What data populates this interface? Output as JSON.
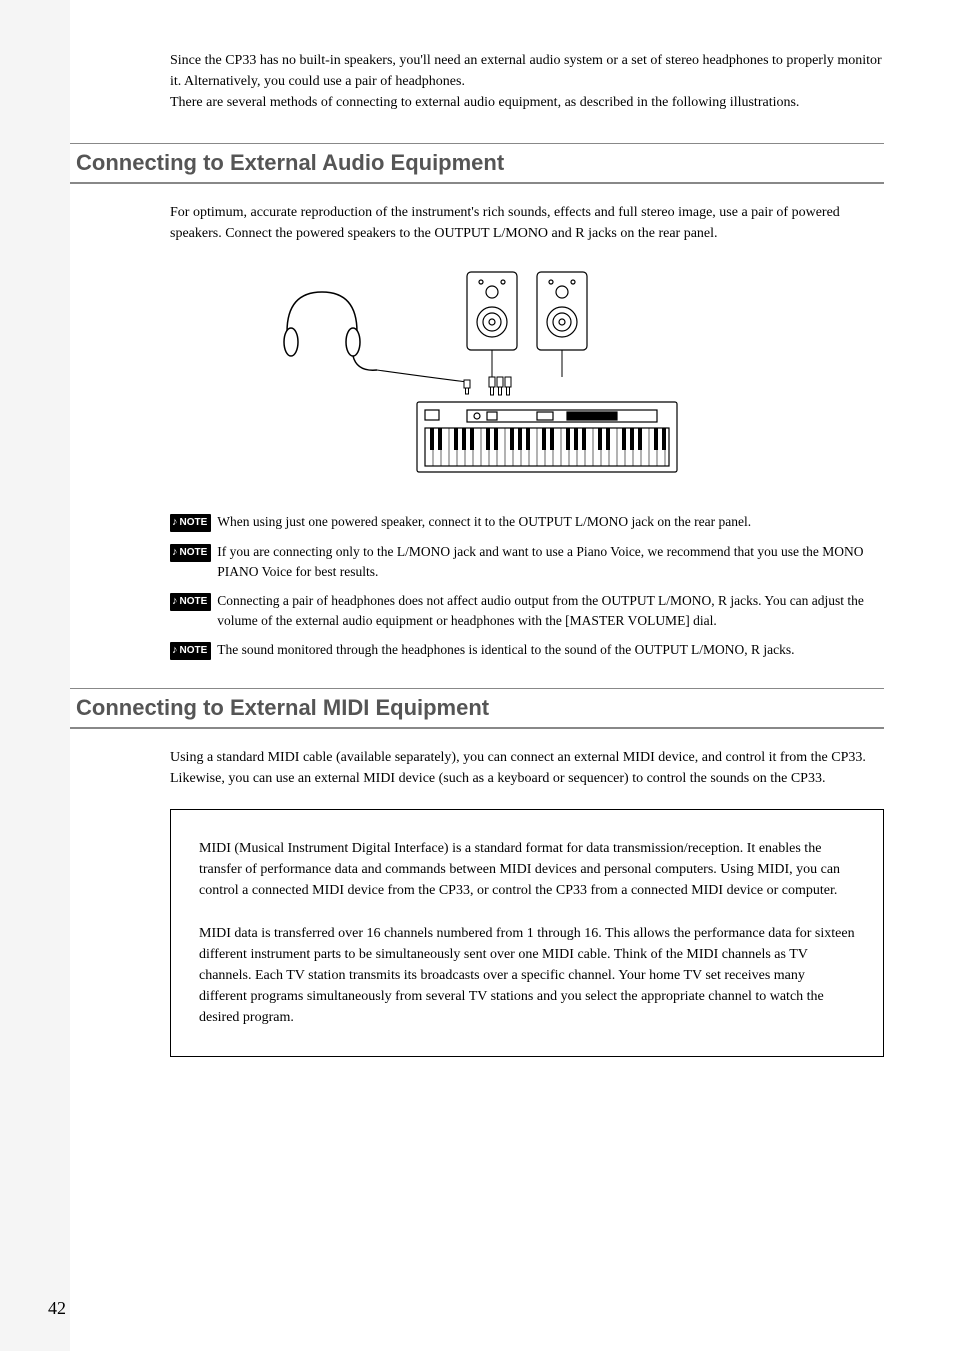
{
  "intro": {
    "p1": "Since the CP33 has no built-in speakers, you'll need an external audio system or a set of stereo headphones to properly monitor it. Alternatively, you could use a pair of headphones.",
    "p2": "There are several methods of connecting to external audio equipment, as described in the following illustrations."
  },
  "section1": {
    "heading": "Connecting to External Audio Equipment",
    "body": "For optimum, accurate reproduction of the instrument's rich sounds, effects and full stereo image, use a pair of powered speakers. Connect the powered speakers to the OUTPUT L/MONO and R jacks on the rear panel.",
    "notes": [
      "When using just one powered speaker, connect it to the OUTPUT L/MONO jack on the rear panel.",
      "If you are connecting only to the L/MONO jack and want to use a Piano Voice, we recommend that you use the MONO PIANO Voice for best results.",
      "Connecting a pair of headphones does not affect audio output from the OUTPUT L/MONO, R jacks. You can adjust the volume of the external audio equipment or headphones with the [MASTER VOLUME] dial.",
      "The sound monitored through the headphones is identical to the sound of the OUTPUT L/MONO, R jacks."
    ]
  },
  "section2": {
    "heading": "Connecting to External MIDI Equipment",
    "body": "Using a standard MIDI cable (available separately), you can connect an external MIDI device, and control it from the CP33. Likewise, you can use an external MIDI device (such as a keyboard or sequencer) to control the sounds on the CP33.",
    "box": {
      "p1": "MIDI (Musical Instrument Digital Interface) is a standard format for data transmission/reception. It enables the transfer of performance data and commands between MIDI devices and personal computers. Using MIDI, you can control a connected MIDI device from the CP33, or control the CP33 from a connected MIDI device or computer.",
      "p2": "MIDI data is transferred over 16 channels numbered from 1 through 16. This allows the performance data for sixteen different instrument parts to be simultaneously sent over one MIDI cable. Think of the MIDI channels as TV channels. Each TV station transmits its broadcasts over a specific channel. Your home TV set receives many different programs simultaneously from several TV stations and you select the appropriate channel to watch the desired program."
    }
  },
  "note_label": "NOTE",
  "page_number": "42"
}
